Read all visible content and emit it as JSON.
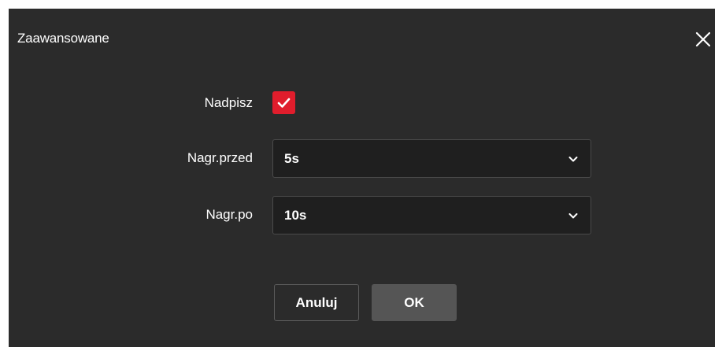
{
  "dialog": {
    "title": "Zaawansowane",
    "close_icon": "close-icon"
  },
  "form": {
    "overwrite": {
      "label": "Nadpisz",
      "checked": true,
      "accent_color": "#e01d2c"
    },
    "pre_record": {
      "label": "Nagr.przed",
      "value": "5s"
    },
    "post_record": {
      "label": "Nagr.po",
      "value": "10s"
    }
  },
  "buttons": {
    "cancel_label": "Anuluj",
    "ok_label": "OK"
  }
}
